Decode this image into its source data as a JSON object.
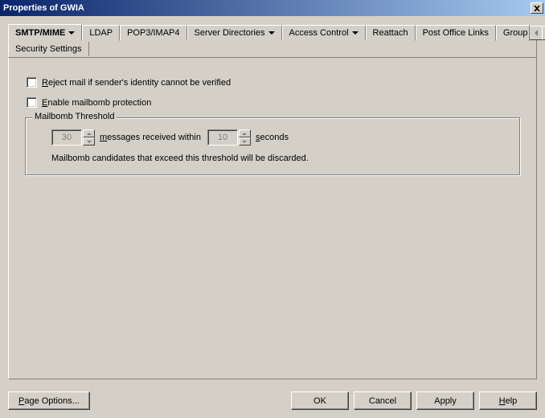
{
  "title": "Properties of GWIA",
  "tabs": [
    {
      "label": "SMTP/MIME",
      "has_dropdown": true,
      "active": true
    },
    {
      "label": "LDAP"
    },
    {
      "label": "POP3/IMAP4"
    },
    {
      "label": "Server Directories",
      "has_dropdown": true
    },
    {
      "label": "Access Control",
      "has_dropdown": true
    },
    {
      "label": "Reattach"
    },
    {
      "label": "Post Office Links"
    },
    {
      "label": "Group"
    }
  ],
  "subtab": "Security Settings",
  "form": {
    "reject_label_pre": "R",
    "reject_label_rest": "eject mail if sender's identity cannot be verified",
    "enable_label_pre": "E",
    "enable_label_rest": "nable mailbomb protection",
    "group_legend": "Mailbomb Threshold",
    "spin1_value": "30",
    "mid_text_pre": "m",
    "mid_text_rest": "essages received within",
    "spin2_value": "10",
    "end_text_pre": "s",
    "end_text_rest": "econds",
    "note": "Mailbomb candidates that exceed this threshold will be discarded."
  },
  "buttons": {
    "page_options_pre": "P",
    "page_options_rest": "age Options...",
    "ok": "OK",
    "cancel": "Cancel",
    "apply": "Apply",
    "help_pre": "H",
    "help_rest": "elp"
  }
}
